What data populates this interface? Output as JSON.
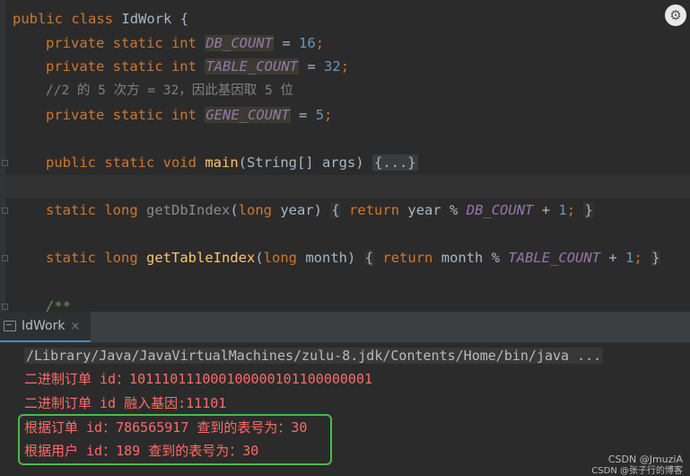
{
  "editor": {
    "class_decl": {
      "kw1": "public",
      "kw2": "class",
      "name": "IdWork",
      "brace": "{"
    },
    "field_db": {
      "mods": "private static int",
      "name": "DB_COUNT",
      "op": "=",
      "value": "16",
      "end": ";"
    },
    "field_table": {
      "mods": "private static int",
      "name": "TABLE_COUNT",
      "op": "=",
      "value": "32",
      "end": ";"
    },
    "comment": "//2 的 5 次方 = 32，因此基因取 5 位",
    "field_gene": {
      "mods": "private static int",
      "name": "GENE_COUNT",
      "op": "=",
      "value": "5",
      "end": ";"
    },
    "main_method": {
      "mods": "public static void",
      "name": "main",
      "params": "(String[] args)",
      "folded": "{...}"
    },
    "db_method": {
      "mods": "static long",
      "name": "getDbIndex",
      "p_open": "(",
      "p_type": "long",
      "p_name": "year",
      "p_close": ")",
      "open": "{",
      "ret": "return",
      "expr1": "year %",
      "const": "DB_COUNT",
      "plus": "+",
      "num": "1",
      "semi": ";",
      "close": "}"
    },
    "table_method": {
      "mods": "static long",
      "name": "getTableIndex",
      "p_open": "(",
      "p_type": "long",
      "p_name": "month",
      "p_close": ")",
      "open": "{",
      "ret": "return",
      "expr1": "month %",
      "const": "TABLE_COUNT",
      "plus": "+",
      "num": "1",
      "semi": ";",
      "close": "}"
    },
    "javadoc_start": "/**"
  },
  "toolbar": {
    "settings_icon": "settings-icon"
  },
  "run_panel": {
    "tab_label": "IdWork",
    "tab_close": "×",
    "command": "/Library/Java/JavaVirtualMachines/zulu-8.jdk/Contents/Home/bin/java ...",
    "output": [
      "二进制订单 id：10111011100010000010110000000​1",
      "二进制订单 id 融入基因:11101",
      "根据订单 id：786565917 查到的表号为：30",
      "根据用户 id：189 查到的表号为：30"
    ]
  },
  "watermark": {
    "line1": "CSDN @JmuziA",
    "line2": "CSDN @张子行的博客"
  },
  "colors": {
    "keyword": "#cc7832",
    "number": "#6897bb",
    "static_field": "#9876aa",
    "method": "#ffc66d",
    "console_output": "#ff6b68",
    "highlight_box": "#4db84d"
  }
}
